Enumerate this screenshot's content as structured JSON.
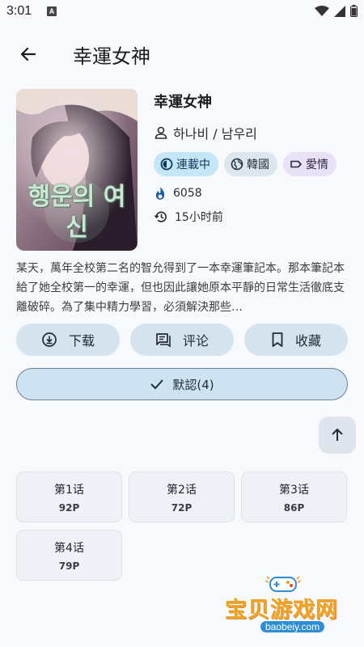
{
  "status_bar": {
    "time": "3:01",
    "notification_glyph": "A"
  },
  "app_bar": {
    "title": "幸運女神"
  },
  "manga": {
    "title": "幸運女神",
    "authors": "하나비 / 남우리",
    "status": "連載中",
    "country": "韓國",
    "genre": "愛情",
    "views": "6058",
    "updated": "15小时前",
    "summary": "某天，萬年全校第二名的智允得到了一本幸運筆記本。那本筆記本給了她全校第一的幸運，但也因此讓她原本平靜的日常生活徹底支離破碎。為了集中精力學習，必須解決那些…",
    "cover_title_art": "행운의 여신"
  },
  "actions": {
    "download": "下载",
    "comment": "评论",
    "favorite": "收藏"
  },
  "default_button": "默認(4)",
  "chapters": [
    {
      "title": "第1话",
      "pages": "92P"
    },
    {
      "title": "第2话",
      "pages": "72P"
    },
    {
      "title": "第3话",
      "pages": "86P"
    },
    {
      "title": "第4话",
      "pages": "79P"
    }
  ],
  "watermark": {
    "name": "宝贝游戏网",
    "url": "baobeiy.com"
  },
  "colors": {
    "accent": "#c5e6f7",
    "button_bg": "#d5e3ef",
    "page_bg": "#f7f9fc"
  },
  "icons": {
    "back": "arrow-left-icon",
    "author": "person-icon",
    "status": "half-circle-icon",
    "country": "globe-icon",
    "genre": "tag-icon",
    "views": "flame-icon",
    "updated": "history-icon",
    "download": "download-circle-icon",
    "comment": "comment-icon",
    "favorite": "bookmark-icon",
    "default": "check-icon",
    "scroll_top": "arrow-up-icon"
  }
}
